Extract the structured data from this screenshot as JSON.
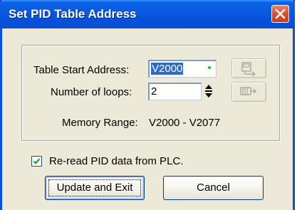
{
  "window": {
    "title": "Set PID Table Address"
  },
  "form": {
    "start_address_label": "Table Start Address:",
    "start_address_value": "V2000",
    "loops_label": "Number of loops:",
    "loops_value": "2",
    "memory_range_label": "Memory Range:",
    "memory_range_value": "V2000 - V2077"
  },
  "options": {
    "reread_label": "Re-read PID data from PLC.",
    "reread_checked": true
  },
  "buttons": {
    "update_label": "Update and Exit",
    "cancel_label": "Cancel"
  },
  "icons": {
    "close": "close-icon",
    "spinner": "spinner-arrows-icon",
    "write": "write-to-plc-icon",
    "read": "read-from-plc-icon",
    "checkmark": "checkmark-icon"
  },
  "colors": {
    "title_bar": "#0a5ae0",
    "close_button": "#d6522f",
    "selection": "#316ac5",
    "dialog_background": "#ece9d8"
  }
}
